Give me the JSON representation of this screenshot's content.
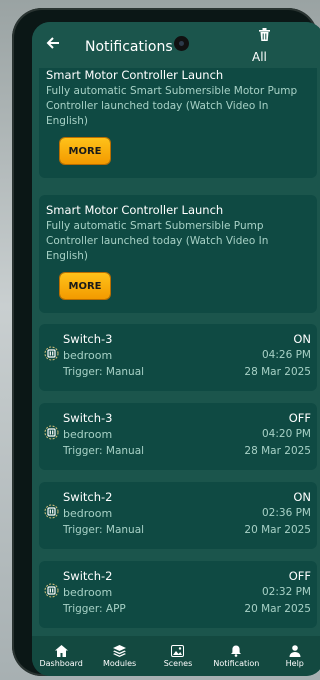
{
  "header": {
    "title": "Notifications",
    "delete_all_label": "All"
  },
  "promos": [
    {
      "title": "Smart Motor Controller Launch",
      "description": "Fully automatic Smart Submersible Motor Pump Controller launched today (Watch Video In English)",
      "button": "MORE"
    },
    {
      "title": "Smart Motor Controller Launch",
      "description": "Fully automatic Smart Submersible Pump Controller launched today (Watch Video In English)",
      "button": "MORE"
    }
  ],
  "switches": [
    {
      "name": "Switch-3",
      "state": "ON",
      "location": "bedroom",
      "time": "04:26 PM",
      "trigger": "Trigger: Manual",
      "date": "28 Mar 2025"
    },
    {
      "name": "Switch-3",
      "state": "OFF",
      "location": "bedroom",
      "time": "04:20 PM",
      "trigger": "Trigger: Manual",
      "date": "28 Mar 2025"
    },
    {
      "name": "Switch-2",
      "state": "ON",
      "location": "bedroom",
      "time": "02:36 PM",
      "trigger": "Trigger: Manual",
      "date": "20 Mar 2025"
    },
    {
      "name": "Switch-2",
      "state": "OFF",
      "location": "bedroom",
      "time": "02:32 PM",
      "trigger": "Trigger: APP",
      "date": "20 Mar 2025"
    }
  ],
  "nav": [
    {
      "label": "Dashboard",
      "icon": "home-icon"
    },
    {
      "label": "Modules",
      "icon": "layers-icon"
    },
    {
      "label": "Scenes",
      "icon": "image-icon"
    },
    {
      "label": "Notification",
      "icon": "bell-icon"
    },
    {
      "label": "Help",
      "icon": "person-icon"
    }
  ],
  "colors": {
    "background": "#1b554c",
    "card": "#0f4a43",
    "accent": "#f7a600",
    "muted_text": "#a7d1c6"
  }
}
